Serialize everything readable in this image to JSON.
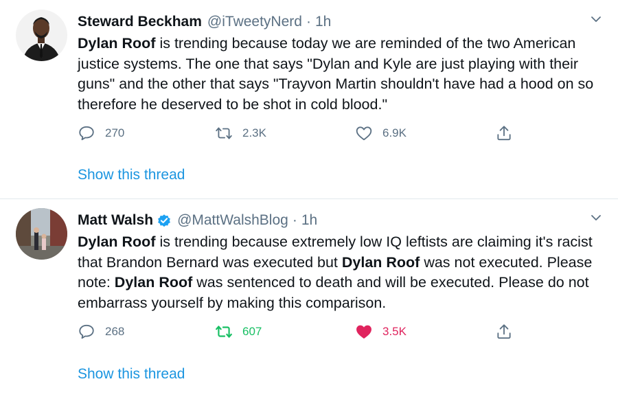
{
  "tweets": [
    {
      "author_name": "Steward Beckham",
      "handle": "@iTweetyNerd",
      "separator": "·",
      "time": "1h",
      "verified": false,
      "text_parts": [
        {
          "t": "Dylan Roof",
          "bold": true
        },
        {
          "t": " is trending because today we are reminded of the two American justice systems. The one that says \"Dylan and Kyle are just playing with their guns\" and the other that says \"Trayvon Martin shouldn't have had a hood on so therefore he deserved to be shot in cold blood.\"",
          "bold": false
        }
      ],
      "replies": "270",
      "retweets": "2.3K",
      "likes": "6.9K",
      "retweeted": false,
      "liked": false,
      "show_thread": "Show this thread"
    },
    {
      "author_name": "Matt Walsh",
      "handle": "@MattWalshBlog",
      "separator": "·",
      "time": "1h",
      "verified": true,
      "text_parts": [
        {
          "t": "Dylan Roof",
          "bold": true
        },
        {
          "t": " is trending because extremely low IQ leftists are claiming it's racist that Brandon Bernard was executed but ",
          "bold": false
        },
        {
          "t": "Dylan Roof",
          "bold": true
        },
        {
          "t": " was not executed. Please note: ",
          "bold": false
        },
        {
          "t": "Dylan Roof",
          "bold": true
        },
        {
          "t": " was sentenced to death and will be executed. Please do not embarrass yourself by making this comparison.",
          "bold": false
        }
      ],
      "replies": "268",
      "retweets": "607",
      "likes": "3.5K",
      "retweeted": true,
      "liked": true,
      "show_thread": "Show this thread"
    }
  ],
  "colors": {
    "link": "#1b95e0",
    "muted": "#5b7083",
    "retweet_active": "#17bf63",
    "like_active": "#e0245e",
    "verified": "#1da1f2"
  }
}
